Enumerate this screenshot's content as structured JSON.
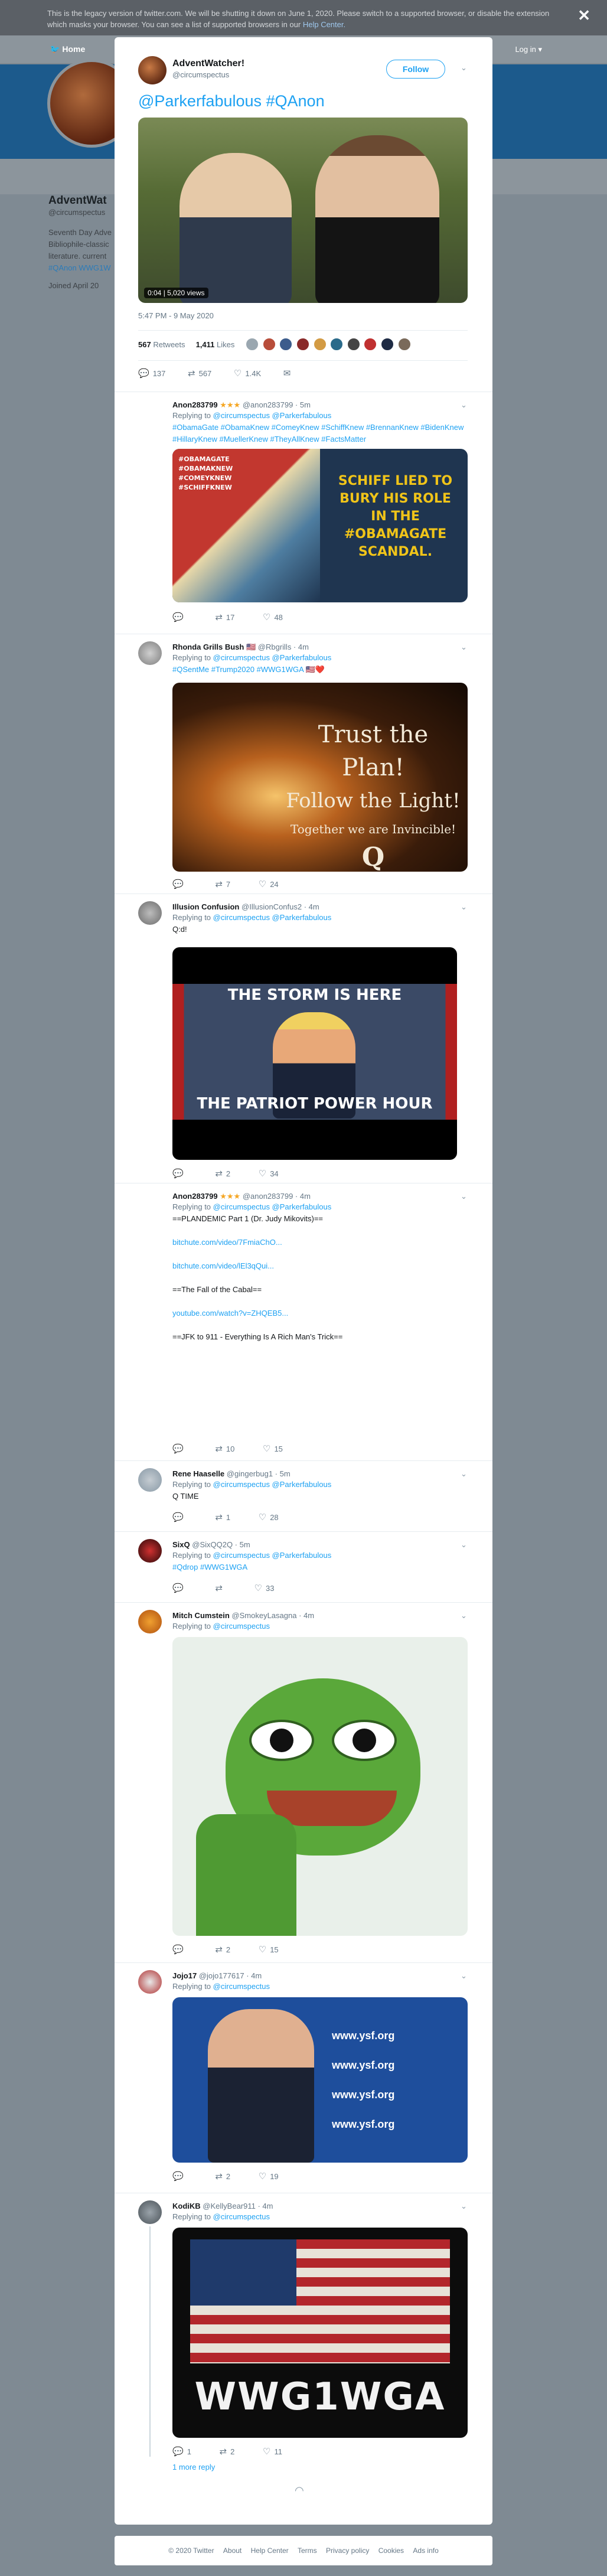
{
  "banner": {
    "text": "This is the legacy version of twitter.com. We will be shutting it down on June 1, 2020. Please switch to a supported browser, or disable the extension which masks your browser. You can see a list of supported browsers in our",
    "link": "Help Center.",
    "close": "✕"
  },
  "nav": {
    "home": "Home",
    "login": "Log in ▾"
  },
  "profile": {
    "name": "AdventWat",
    "handle": "@circumspectus",
    "bio": "Seventh Day Adve Bibliophile-classic literature. current",
    "hashtags": "#QAnon WWG1W",
    "joined": "Joined April 20"
  },
  "main": {
    "name": "AdventWatcher!",
    "handle": "@circumspectus",
    "follow": "Follow",
    "text": "@Parkerfabulous #QAnon",
    "video_time": "0:04",
    "video_views": "5,020 views",
    "timestamp": "5:47 PM - 9 May 2020",
    "retweets_count": "567",
    "retweets_label": "Retweets",
    "likes_count": "1,411",
    "likes_label": "Likes",
    "actions": {
      "replies": "137",
      "retweets": "567",
      "likes": "1.4K"
    }
  },
  "replies": [
    {
      "name": "Anon283799",
      "badge": "★★★",
      "handle": "@anon283799 · 5m",
      "replying_prefix": "Replying to",
      "replying": "@circumspectus @Parkerfabulous",
      "text": "#ObamaGate #ObamaKnew #ComeyKnew #SchiffKnew #BrennanKnew #BidenKnew #HillaryKnew #MuellerKnew #TheyAllKnew #FactsMatter",
      "poster_tags": "#OBAMAGATE\n#OBAMAKNEW\n#COMEYKNEW\n#SCHIFFKNEW",
      "poster_caption": "SCHIFF LIED TO BURY HIS ROLE IN THE #OBAMAGATE SCANDAL.",
      "actions": {
        "replies": "",
        "retweets": "17",
        "likes": "48"
      }
    },
    {
      "name": "Rhonda Grills Bush",
      "badge": "🇺🇸",
      "handle": "@Rbgrills · 4m",
      "replying_prefix": "Replying to",
      "replying": "@circumspectus @Parkerfabulous",
      "text": "#QSentMe #Trump2020 #WWG1WGA 🇺🇸❤️",
      "poster_line1": "Trust the Plan!",
      "poster_line2": "Follow the Light!",
      "poster_line3": "Together we are Invincible!",
      "poster_q": "Q",
      "actions": {
        "replies": "",
        "retweets": "7",
        "likes": "24"
      }
    },
    {
      "name": "Illusion Confusion",
      "badge": "",
      "handle": "@IllusionConfus2 · 4m",
      "replying_prefix": "Replying to",
      "replying": "@circumspectus @Parkerfabulous",
      "text": "Q:d!",
      "poster_top": "THE STORM IS HERE",
      "poster_bottom": "THE PATRIOT POWER HOUR",
      "actions": {
        "replies": "",
        "retweets": "2",
        "likes": "34"
      }
    },
    {
      "name": "Anon283799",
      "badge": "★★★",
      "handle": "@anon283799 · 4m",
      "replying_prefix": "Replying to",
      "replying": "@circumspectus @Parkerfabulous",
      "line1": "==PLANDEMIC Part 1 (Dr. Judy Mikovits)==",
      "link1": "bitchute.com/video/7FmiaChO...",
      "link2": "bitchute.com/video/lEl3qQui...",
      "line2": "==The Fall of the Cabal==",
      "link3": "youtube.com/watch?v=ZHQEB5...",
      "line3": "==JFK to 911 - Everything Is A Rich Man's Trick==",
      "actions": {
        "replies": "",
        "retweets": "10",
        "likes": "15"
      }
    },
    {
      "name": "Rene Haaselle",
      "badge": "",
      "handle": "@gingerbug1 · 5m",
      "replying_prefix": "Replying to",
      "replying": "@circumspectus @Parkerfabulous",
      "text": "Q TIME",
      "actions": {
        "replies": "",
        "retweets": "1",
        "likes": "28"
      }
    },
    {
      "name": "SixQ",
      "badge": "",
      "handle": "@SixQQ2Q · 5m",
      "replying_prefix": "Replying to",
      "replying": "@circumspectus @Parkerfabulous",
      "text": "#Qdrop #WWG1WGA",
      "actions": {
        "replies": "",
        "retweets": "",
        "likes": "33"
      }
    },
    {
      "name": "Mitch Cumstein",
      "badge": "",
      "handle": "@SmokeyLasagna · 4m",
      "replying_prefix": "Replying to",
      "replying": "@circumspectus",
      "actions": {
        "replies": "",
        "retweets": "2",
        "likes": "15"
      }
    },
    {
      "name": "Jojo17",
      "badge": "",
      "handle": "@jojo177617 · 4m",
      "replying_prefix": "Replying to",
      "replying": "@circumspectus",
      "poster_brand": "www.ysf.org",
      "actions": {
        "replies": "",
        "retweets": "2",
        "likes": "19"
      }
    },
    {
      "name": "KodiKB",
      "badge": "",
      "handle": "@KellyBear911 · 4m",
      "replying_prefix": "Replying to",
      "replying": "@circumspectus",
      "poster_text": "WWG1WGA",
      "actions": {
        "replies": "1",
        "retweets": "2",
        "likes": "11"
      },
      "more": "1 more reply"
    }
  ],
  "footer": [
    "© 2020 Twitter",
    "About",
    "Help Center",
    "Terms",
    "Privacy policy",
    "Cookies",
    "Ads info"
  ]
}
